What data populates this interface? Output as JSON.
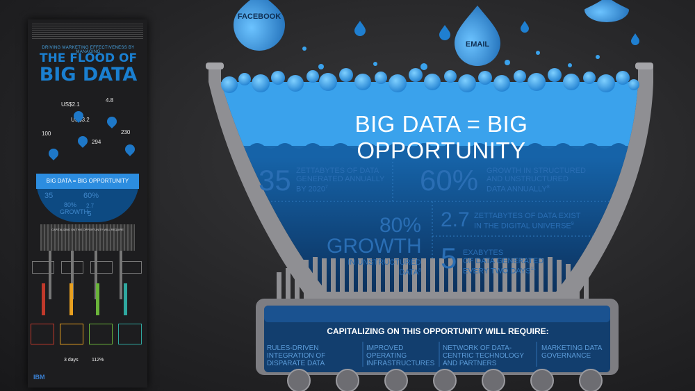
{
  "colors": {
    "background": "#262628",
    "water_light": "#3da8f0",
    "water_dark": "#0d3a6c",
    "stat_text": "#2a6eb4",
    "metal": "#8f8f93"
  },
  "thumbnail": {
    "kicker": "DRIVING MARKETING EFFECTIVENESS BY MANAGING",
    "title_line1": "THE FLOOD OF",
    "title_line2": "BIG DATA",
    "stat_a": "US$2.1",
    "stat_b": "4.8",
    "stat_c": "US$3.2",
    "stat_d": "100",
    "stat_e": "294",
    "stat_f": "230",
    "bowl_title": "BIG DATA = BIG OPPORTUNITY",
    "mini_35": "35",
    "mini_60": "60%",
    "mini_80": "80%",
    "mini_growth": "GROWTH",
    "mini_27": "2.7",
    "mini_5": "5",
    "machine_label": "CAPITALIZING ON THIS OPPORTUNITY WILL REQUIRE",
    "bottom_1": "3 days",
    "bottom_2": "112%",
    "logo": "IBM"
  },
  "drops": {
    "facebook": "FACEBOOK",
    "email": "EMAIL"
  },
  "headline": "BIG DATA = BIG OPPORTUNITY",
  "stats": {
    "s1_value": "35",
    "s1_text_1": "ZETTABYTES OF DATA",
    "s1_text_2": "GENERATED ANNUALLY",
    "s1_text_3": "BY 2020",
    "s1_note": "7",
    "s2_value": "60%",
    "s2_text_1": "GROWTH IN STRUCTURED",
    "s2_text_2": "AND UNSTRUCTURED",
    "s2_text_3": "DATA ANNUALLY",
    "s2_note": "8",
    "s3_value": "80%",
    "s3_value_2": "GROWTH",
    "s3_text": "IN UNSTRUCTURED DATA",
    "s3_note": "8",
    "s4_value": "2.7",
    "s4_text_1": "ZETTABYTES OF DATA EXIST",
    "s4_text_2": "IN THE DIGITAL UNIVERSE",
    "s4_note": "9",
    "s5_value": "5",
    "s5_text_1": "EXABYTES",
    "s5_text_2": "OF DATA GENERATED",
    "s5_text_3": "EVERY TWO DAYS",
    "s5_note": "11"
  },
  "requirements": {
    "heading": "CAPITALIZING ON THIS OPPORTUNITY WILL REQUIRE:",
    "items": [
      "RULES-DRIVEN INTEGRATION OF DISPARATE DATA",
      "IMPROVED OPERATING INFRASTRUCTURES",
      "NETWORK OF DATA-CENTRIC TECHNOLOGY AND PARTNERS",
      "MARKETING DATA GOVERNANCE"
    ]
  }
}
